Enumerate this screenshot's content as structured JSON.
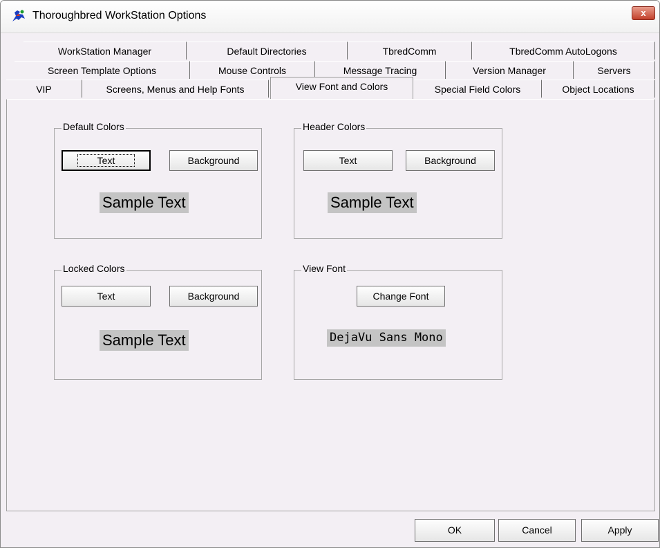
{
  "window": {
    "title": "Thoroughbred WorkStation Options",
    "close_label": "x"
  },
  "tabs": {
    "row1": [
      {
        "label": "WorkStation Manager"
      },
      {
        "label": "Default Directories"
      },
      {
        "label": "TbredComm"
      },
      {
        "label": "TbredComm AutoLogons"
      }
    ],
    "row2": [
      {
        "label": "Screen Template Options"
      },
      {
        "label": "Mouse Controls"
      },
      {
        "label": "Message Tracing"
      },
      {
        "label": "Version Manager"
      },
      {
        "label": "Servers"
      }
    ],
    "row3": [
      {
        "label": "VIP"
      },
      {
        "label": "Screens, Menus and Help Fonts"
      },
      {
        "label": "View Font and Colors"
      },
      {
        "label": "Special Field Colors"
      },
      {
        "label": "Object Locations"
      }
    ],
    "selected": "View Font and Colors"
  },
  "default_colors": {
    "title": "Default Colors",
    "text_btn": "Text",
    "background_btn": "Background",
    "sample": "Sample Text"
  },
  "header_colors": {
    "title": "Header Colors",
    "text_btn": "Text",
    "background_btn": "Background",
    "sample": "Sample Text"
  },
  "locked_colors": {
    "title": "Locked Colors",
    "text_btn": "Text",
    "background_btn": "Background",
    "sample": "Sample Text"
  },
  "view_font": {
    "title": "View Font",
    "change_btn": "Change Font",
    "sample": "DejaVu Sans Mono"
  },
  "footer": {
    "ok": "OK",
    "cancel": "Cancel",
    "apply": "Apply"
  }
}
